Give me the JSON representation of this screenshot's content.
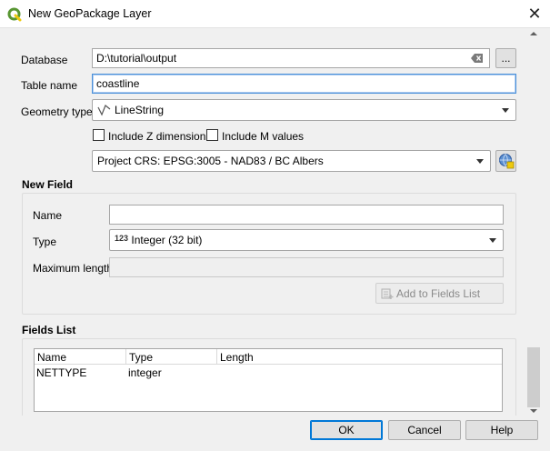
{
  "window": {
    "title": "New GeoPackage Layer"
  },
  "form": {
    "database_label": "Database",
    "database_value": "D:\\tutorial\\output",
    "browse_label": "...",
    "table_name_label": "Table name",
    "table_name_value": "coastline",
    "geometry_type_label": "Geometry type",
    "geometry_type_value": "LineString",
    "include_z_label": "Include Z dimension",
    "include_m_label": "Include M values",
    "crs_value": "Project CRS: EPSG:3005 - NAD83 / BC Albers"
  },
  "new_field": {
    "title": "New Field",
    "name_label": "Name",
    "name_value": "",
    "type_label": "Type",
    "type_prefix": "123",
    "type_value": "Integer (32 bit)",
    "max_length_label": "Maximum length",
    "add_button_label": "Add to Fields List"
  },
  "fields_list": {
    "title": "Fields List",
    "columns": [
      "Name",
      "Type",
      "Length"
    ],
    "rows": [
      {
        "name": "NETTYPE",
        "type": "integer",
        "length": ""
      }
    ]
  },
  "buttons": {
    "ok": "OK",
    "cancel": "Cancel",
    "help": "Help"
  },
  "colors": {
    "accent": "#0078d7",
    "qgis_green": "#589632",
    "qgis_yellow": "#eec90d"
  },
  "icons": [
    "qgis-logo-icon",
    "close-icon",
    "clear-text-icon",
    "linestring-icon",
    "dropdown-arrow-icon",
    "crs-globe-icon",
    "add-field-icon"
  ]
}
